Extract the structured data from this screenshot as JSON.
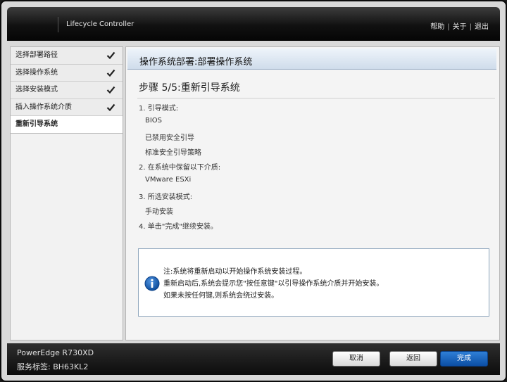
{
  "header": {
    "app_title": "Lifecycle Controller",
    "help": "帮助",
    "about": "关于",
    "exit": "退出",
    "separator": "|"
  },
  "sidebar": {
    "items": [
      {
        "label": "选择部署路径",
        "done": true
      },
      {
        "label": "选择操作系统",
        "done": true
      },
      {
        "label": "选择安装模式",
        "done": true
      },
      {
        "label": "插入操作系统介质",
        "done": true
      },
      {
        "label": "重新引导系统",
        "done": false,
        "active": true
      }
    ]
  },
  "main": {
    "title": "操作系统部署:部署操作系统",
    "step_title": "步骤 5/5:重新引导系统",
    "lines": [
      "1. 引导模式:",
      "BIOS",
      "已禁用安全引导",
      "标准安全引导策略",
      "2. 在系统中保留以下介质:",
      "VMware ESXi",
      "3.  所选安装模式:",
      "手动安装",
      "4. 单击\"完成\"继续安装。"
    ],
    "note": {
      "line1": "注:系统将重新启动以开始操作系统安装过程。",
      "line2": "重新启动后,系统会提示您\"按任意键\"以引导操作系统介质并开始安装。",
      "line3": "如果未按任何键,则系统会绕过安装。",
      "icon": "info-icon"
    }
  },
  "footer": {
    "model": "PowerEdge R730XD",
    "service_tag": "服务标签: BH63KL2",
    "buttons": {
      "cancel": "取消",
      "back": "返回",
      "finish": "完成"
    }
  },
  "colors": {
    "accent_blue": "#0b4ea4",
    "title_bar": "#cfdceb",
    "check": "#222222"
  }
}
